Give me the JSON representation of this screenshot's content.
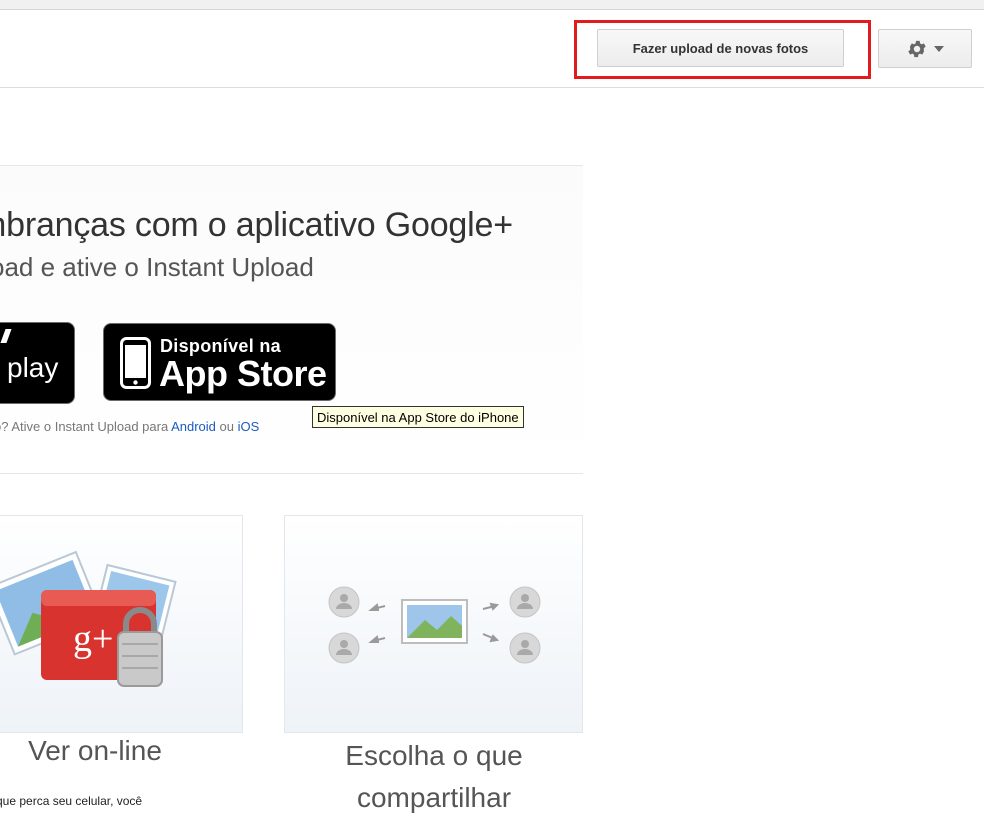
{
  "toolbar": {
    "upload_label": "Fazer upload de novas fotos",
    "settings_icon": "gear-icon",
    "settings_dropdown_icon": "chevron-down-icon"
  },
  "promo": {
    "title": "mbranças com o aplicativo Google+",
    "subtitle": "oad e ative o Instant Upload",
    "google_play": {
      "label": "play"
    },
    "app_store": {
      "small_text": "Disponível na",
      "big_text": "App Store"
    },
    "tooltip": "Disponível na App Store do iPhone",
    "hint": {
      "prefix": "o? Ative o Instant Upload para ",
      "android_link": "Android",
      "separator": " ou ",
      "ios_link": "iOS"
    }
  },
  "features": [
    {
      "title": "Ver on-line",
      "description": "que perca seu celular, você"
    },
    {
      "title": "Escolha o que compartilhar",
      "description": ""
    }
  ],
  "colors": {
    "highlight": "#e21c1c",
    "link": "#1a5bbf",
    "google_plus_red": "#d8332f"
  }
}
